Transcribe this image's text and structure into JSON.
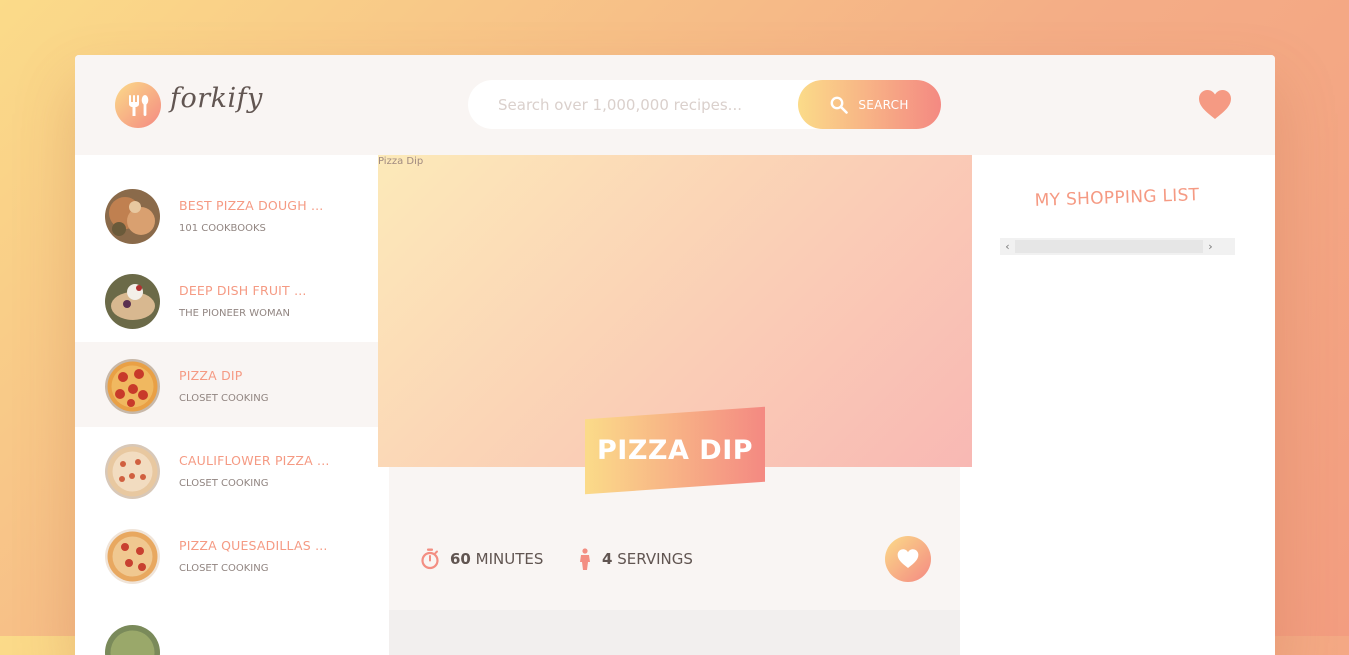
{
  "app": {
    "logo_text": "forkify"
  },
  "header": {
    "search": {
      "placeholder": "Search over 1,000,000 recipes...",
      "value": "",
      "button_label": "Search"
    },
    "likes_icon": "heart-icon"
  },
  "results": [
    {
      "title": "Best Pizza Dough ...",
      "author": "101 Cookbooks",
      "active": false
    },
    {
      "title": "Deep Dish Fruit ...",
      "author": "The Pioneer Woman",
      "active": false
    },
    {
      "title": "Pizza Dip",
      "author": "Closet Cooking",
      "active": true
    },
    {
      "title": "Cauliflower Pizza ...",
      "author": "Closet Cooking",
      "active": false
    },
    {
      "title": "Pizza Quesadillas ...",
      "author": "Closet Cooking",
      "active": false
    }
  ],
  "recipe": {
    "image_alt": "Pizza Dip",
    "title": "Pizza Dip",
    "minutes": "60",
    "minutes_label": "minutes",
    "servings": "4",
    "servings_label": "servings"
  },
  "shopping": {
    "title": "My Shopping List"
  },
  "colors": {
    "accent_start": "#fbdb89",
    "accent_end": "#f48982",
    "title_color": "#f59a83",
    "text_color": "#615551"
  }
}
